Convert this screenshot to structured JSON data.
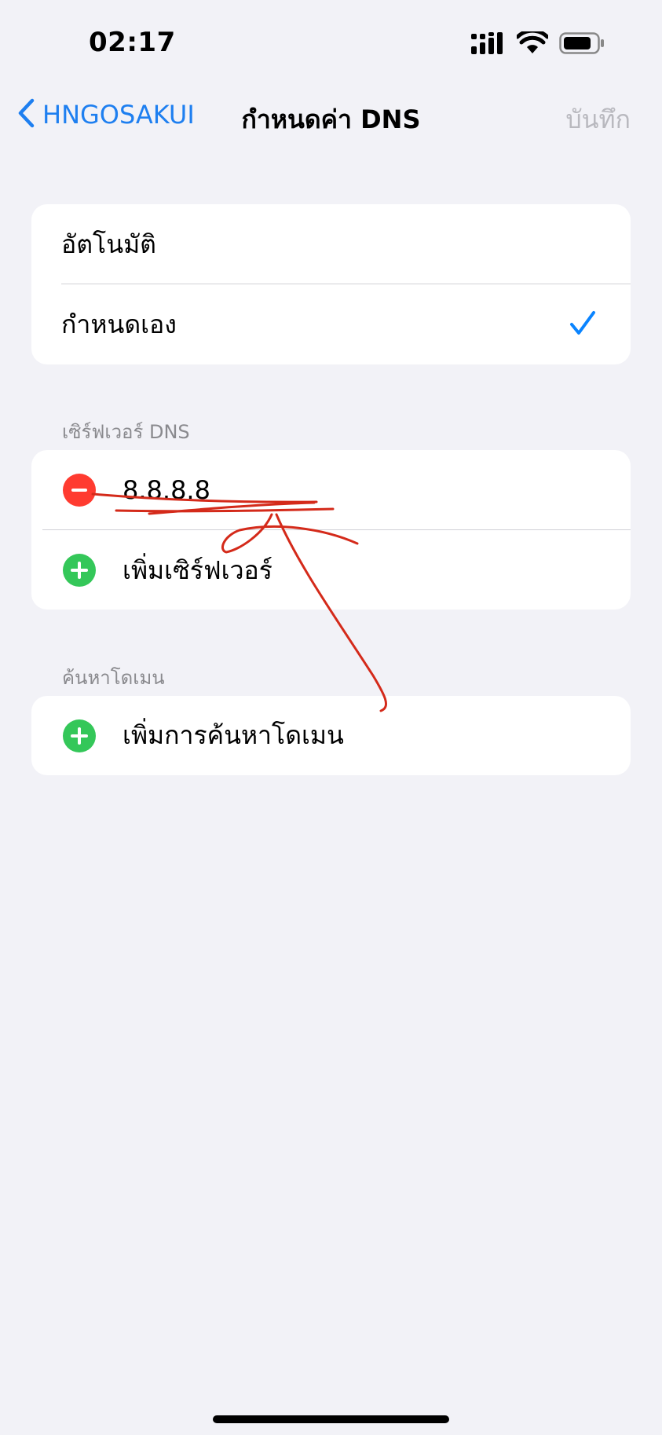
{
  "status_bar": {
    "time": "02:17",
    "icons": [
      "cellular-signal-icon",
      "wifi-icon",
      "battery-icon"
    ]
  },
  "nav": {
    "back_label": "HNGOSAKUI",
    "title": "กำหนดค่า DNS",
    "save_label": "บันทึก"
  },
  "mode_options": {
    "automatic": "อัตโนมัติ",
    "manual": "กำหนดเอง",
    "selected": "manual"
  },
  "dns_servers": {
    "header": "เซิร์ฟเวอร์ DNS",
    "servers": [
      "8.8.8.8"
    ],
    "add_label": "เพิ่มเซิร์ฟเวอร์"
  },
  "search_domains": {
    "header": "ค้นหาโดเมน",
    "add_label": "เพิ่มการค้นหาโดเมน"
  },
  "colors": {
    "accent": "#0a84ff",
    "delete": "#ff3b30",
    "add": "#34c759",
    "annotation": "#d42a1a",
    "background": "#f2f2f7"
  }
}
